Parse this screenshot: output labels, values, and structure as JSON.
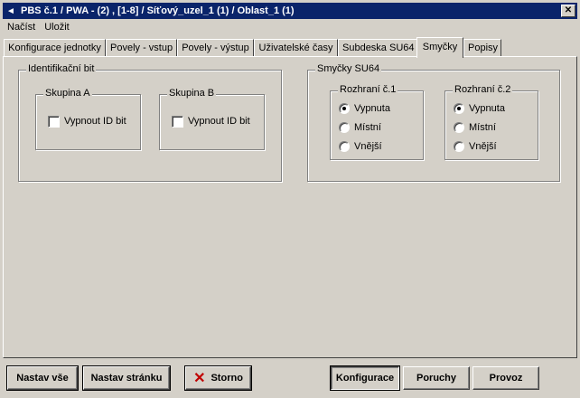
{
  "window": {
    "title": "PBS č.1 / PWA - (2) , [1-8] / Síťový_uzel_1 (1) / Oblast_1 (1)",
    "close_glyph": "✕",
    "app_glyph": "◄"
  },
  "menu": {
    "items": [
      {
        "label": "Načíst",
        "accel": "N"
      },
      {
        "label": "Uložit",
        "accel": "U"
      }
    ]
  },
  "tabs": [
    {
      "label": "Konfigurace jednotky"
    },
    {
      "label": "Povely - vstup"
    },
    {
      "label": "Povely - výstup"
    },
    {
      "label": "Uživatelské časy"
    },
    {
      "label": "Subdeska SU64"
    },
    {
      "label": "Smyčky",
      "active": true
    },
    {
      "label": "Popisy"
    }
  ],
  "id_bit": {
    "title": "Identifikační bit",
    "group_a": {
      "title": "Skupina A",
      "checkbox_label": "Vypnout ID bit",
      "checked": false
    },
    "group_b": {
      "title": "Skupina B",
      "checkbox_label": "Vypnout ID bit",
      "checked": false
    }
  },
  "loops": {
    "title": "Smyčky SU64",
    "interface1": {
      "title": "Rozhraní č.1",
      "options": [
        "Vypnuta",
        "Místní",
        "Vnější"
      ],
      "selected": "Vypnuta"
    },
    "interface2": {
      "title": "Rozhraní č.2",
      "options": [
        "Vypnuta",
        "Místní",
        "Vnější"
      ],
      "selected": "Vypnuta"
    }
  },
  "buttons": {
    "set_all": "Nastav vše",
    "set_page": "Nastav stránku",
    "cancel": "Storno",
    "configuration": "Konfigurace",
    "faults": "Poruchy",
    "operation": "Provoz"
  }
}
